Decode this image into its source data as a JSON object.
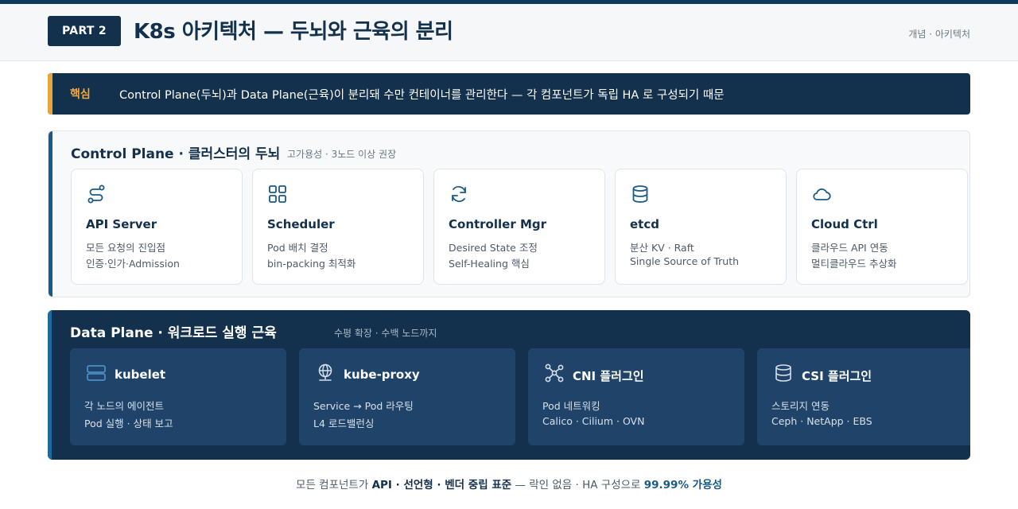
{
  "header": {
    "part_label": "PART 2",
    "title": "K8s 아키텍처 — 두뇌와 근육의 분리",
    "meta": "개념 · 아키텍처"
  },
  "core": {
    "label": "핵심",
    "text": "Control Plane(두뇌)과 Data Plane(근육)이 분리돼 수만 컨테이너를 관리한다 — 각 컴포넌트가 독립 HA 로 구성되기 때문"
  },
  "control_plane": {
    "title": "Control Plane · 클러스터의 두뇌",
    "subtitle": "고가용성 · 3노드 이상 권장",
    "cards": [
      {
        "title": "API Server",
        "line1": "모든 요청의 진입점",
        "line2": "인증·인가·Admission",
        "icon": "route-icon"
      },
      {
        "title": "Scheduler",
        "line1": "Pod 배치 결정",
        "line2": "bin-packing 최적화",
        "icon": "grid-icon"
      },
      {
        "title": "Controller Mgr",
        "line1": "Desired State 조정",
        "line2": "Self-Healing 핵심",
        "icon": "refresh-icon"
      },
      {
        "title": "etcd",
        "line1": "분산 KV · Raft",
        "line2": "Single Source of Truth",
        "icon": "database-icon"
      },
      {
        "title": "Cloud Ctrl",
        "line1": "클라우드 API 연동",
        "line2": "멀티클라우드 추상화",
        "icon": "cloud-icon"
      }
    ]
  },
  "data_plane": {
    "title": "Data Plane · 워크로드 실행 근육",
    "subtitle": "수평 확장 · 수백 노드까지",
    "cards": [
      {
        "title": "kubelet",
        "line1": "각 노드의 에이전트",
        "line2": "Pod 실행 · 상태 보고",
        "icon": "server-icon"
      },
      {
        "title": "kube-proxy",
        "line1": "Service → Pod 라우팅",
        "line2": "L4 로드밸런싱",
        "icon": "network-globe-icon"
      },
      {
        "title": "CNI 플러그인",
        "line1": "Pod 네트워킹",
        "line2": "Calico · Cilium · OVN",
        "icon": "nodes-icon"
      },
      {
        "title": "CSI 플러그인",
        "line1": "스토리지 연동",
        "line2": "Ceph · NetApp · EBS",
        "icon": "storage-icon"
      }
    ]
  },
  "footer": {
    "prefix": "모든 컴포넌트가 ",
    "bold": "API · 선언형 · 벤더 중립 표준",
    "middle": " — 락인 없음 · HA 구성으로 ",
    "highlight": "99.99% 가용성"
  },
  "colors": {
    "navy": "#13304d",
    "accent_orange": "#e8a53a",
    "accent_blue": "#1a5a86"
  }
}
